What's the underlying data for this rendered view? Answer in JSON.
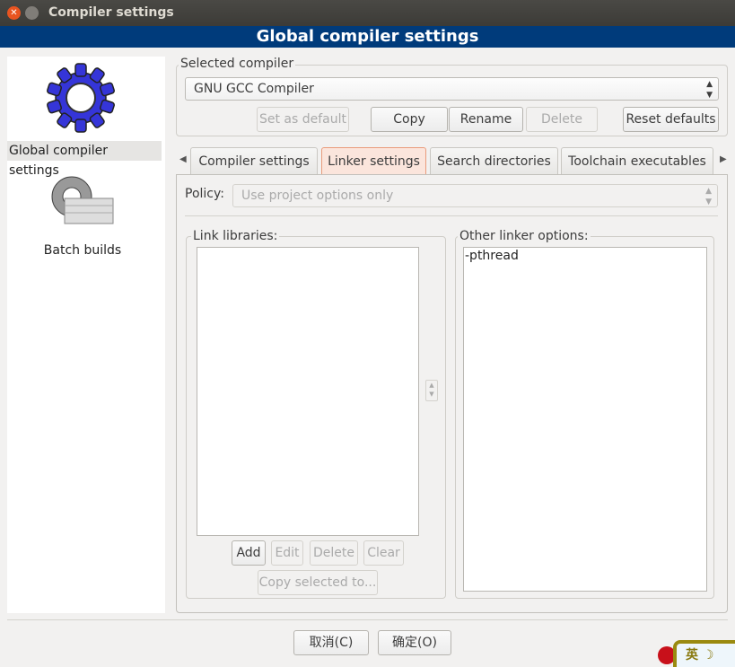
{
  "window": {
    "title": "Compiler settings"
  },
  "header": {
    "title": "Global compiler settings"
  },
  "sidebar": {
    "items": [
      {
        "label": "Global compiler settings",
        "icon": "gear-blue-icon",
        "selected": true
      },
      {
        "label": "Batch builds",
        "icon": "gear-batch-icon",
        "selected": false
      }
    ]
  },
  "compiler": {
    "group_label": "Selected compiler",
    "value": "GNU GCC Compiler",
    "set_default": "Set as default",
    "copy": "Copy",
    "rename": "Rename",
    "delete": "Delete",
    "reset": "Reset defaults"
  },
  "tabs": [
    {
      "label": "Compiler settings"
    },
    {
      "label": "Linker settings",
      "active": true
    },
    {
      "label": "Search directories"
    },
    {
      "label": "Toolchain executables"
    }
  ],
  "policy": {
    "label": "Policy:",
    "value": "Use project options only"
  },
  "link_libraries": {
    "label": "Link libraries:",
    "items": [],
    "add": "Add",
    "edit": "Edit",
    "delete": "Delete",
    "clear": "Clear",
    "copy_selected": "Copy selected to..."
  },
  "other_options": {
    "label": "Other linker options:",
    "value": "-pthread"
  },
  "footer": {
    "cancel": "取消(C)",
    "ok": "确定(O)"
  },
  "ime": {
    "label": "英"
  }
}
